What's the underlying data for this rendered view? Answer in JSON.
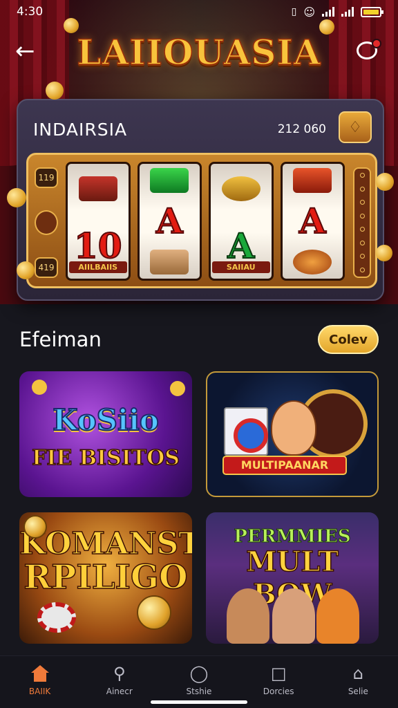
{
  "status_bar": {
    "time": "4:30"
  },
  "header": {
    "logo": "LAIIOUASIA"
  },
  "slot": {
    "title": "INDAIRSIA",
    "balance": "212 060",
    "side_top": "119",
    "side_bottom": "419",
    "reels": [
      {
        "symbol": "10",
        "label": "AIILBAIIS",
        "color": "#e31c12"
      },
      {
        "symbol": "A",
        "label": "",
        "color": "#e31c12"
      },
      {
        "symbol": "A",
        "label": "SAIIAU",
        "color": "#1aa83a"
      },
      {
        "symbol": "A",
        "label": "",
        "color": "#e31c12"
      }
    ]
  },
  "section": {
    "title": "Efeiman",
    "more_label": "Colev"
  },
  "games": [
    {
      "line1": "KoSiio",
      "line2": "FIE BISITOS"
    },
    {
      "label": "MULTIPAANAR"
    },
    {
      "line1": "KOMANST",
      "line2": "RPILIGO"
    },
    {
      "line1": "PERMMIES",
      "line2": "MULT BOW"
    }
  ],
  "nav": [
    {
      "label": "BAIIK",
      "icon": "home-icon"
    },
    {
      "label": "Ainecr",
      "icon": "search-icon"
    },
    {
      "label": "Stshie",
      "icon": "compass-icon"
    },
    {
      "label": "Dorcies",
      "icon": "document-icon"
    },
    {
      "label": "Selie",
      "icon": "store-icon"
    }
  ],
  "colors": {
    "accent": "#f07a3a",
    "gold": "#f8c33c",
    "background": "#14141b"
  }
}
